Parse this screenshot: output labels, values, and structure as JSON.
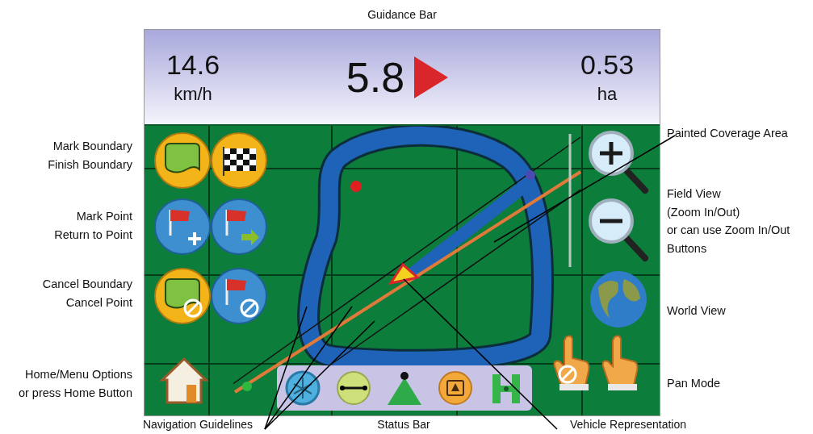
{
  "figure_title": "Guidance Bar",
  "guidance_bar": {
    "speed": "14.6",
    "speed_unit": "km/h",
    "cross_track": "5.8",
    "area": "0.53",
    "area_unit": "ha"
  },
  "left_callouts": [
    {
      "lines": [
        "Mark Boundary",
        "Finish Boundary"
      ]
    },
    {
      "lines": [
        "Mark Point",
        "Return to Point"
      ]
    },
    {
      "lines": [
        "Cancel Boundary",
        "Cancel Point"
      ]
    },
    {
      "lines": [
        "Home/Menu Options",
        "or press Home Button"
      ]
    }
  ],
  "right_callouts": [
    {
      "lines": [
        "Painted Coverage Area"
      ]
    },
    {
      "lines": [
        "Field View",
        "(Zoom In/Out)",
        "or can use Zoom In/Out",
        "Buttons"
      ]
    },
    {
      "lines": [
        "World View"
      ]
    },
    {
      "lines": [
        "Pan Mode"
      ]
    }
  ],
  "bottom_callouts": [
    "Navigation Guidelines",
    "Status Bar",
    "Vehicle Representation"
  ]
}
